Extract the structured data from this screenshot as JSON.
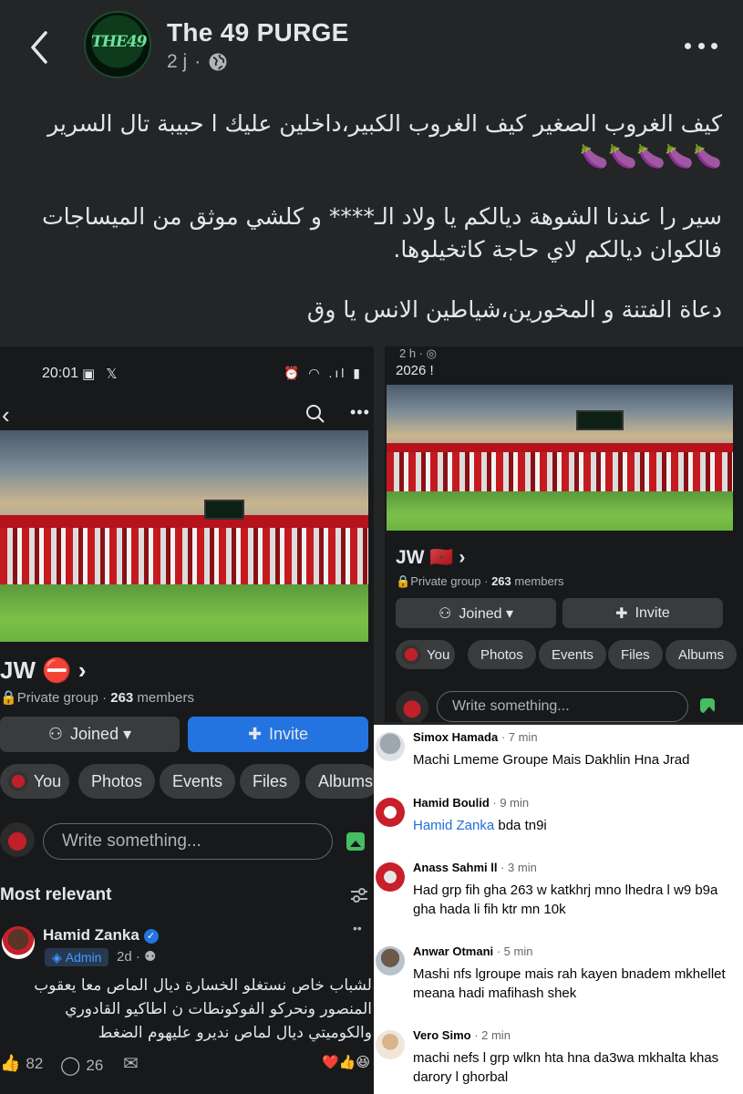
{
  "post": {
    "page_name": "The 49 PURGE",
    "time": "2 j",
    "visibility_separator": "·",
    "logo_text": "THE49",
    "text_lines": [
      "كيف الغروب الصغير كيف الغروب الكبير،داخلين عليك ا حبيبة تال السرير 🍆🍆🍆🍆🍆",
      "سير را عندنا الشوهة ديالكم يا ولاد الـ**** و كلشي موثق من الميساجات فالكوان ديالكم لاي حاجة كاتخيلوها.",
      "دعاة الفتنة و المخورين،شياطين الانس يا وق"
    ]
  },
  "left_shot": {
    "status_time": "20:01",
    "status_icons_left": "▣ 𝕏",
    "status_icons_right": "⏰ ◠ .ıl ▮",
    "group_name": "JW ⛔ ›",
    "group_privacy": "Private group · ",
    "group_members": "263",
    "group_members_label": " members",
    "joined_label": "Joined ▾",
    "invite_label": "Invite",
    "chips": [
      "You",
      "Photos",
      "Events",
      "Files",
      "Albums"
    ],
    "write_placeholder": "Write something...",
    "sort_label": "Most relevant",
    "post_author": "Hamid Zanka",
    "admin_label": "Admin",
    "post_age": "2d ·",
    "post_body": "لشباب خاص نستغلو الخسارة ديال الماص معا يعقوب المنصور ونحركو الفوكونطات ن اطاكيو القادوري والكوميتي ديال لماص نديرو عليهوم الضغط",
    "likes": "82",
    "comments": "26"
  },
  "right_shot": {
    "top_meta": "2 h · ◎",
    "year_text": "2026 !",
    "group_name": "JW 🇲🇦 ›",
    "group_privacy": "Private group · ",
    "group_members": "263",
    "group_members_label": " members",
    "joined_label": "Joined ▾",
    "invite_label": "Invite",
    "chips": [
      "You",
      "Photos",
      "Events",
      "Files",
      "Albums"
    ],
    "write_placeholder": "Write something..."
  },
  "comments": [
    {
      "name": "Simox Hamada",
      "time": " · 7 min",
      "text": "Machi Lmeme Groupe Mais Dakhlin Hna Jrad",
      "mention": ""
    },
    {
      "name": "Hamid Boulid",
      "time": " · 9 min",
      "text": " bda tn9i",
      "mention": "Hamid Zanka"
    },
    {
      "name": "Anass Sahmi ll",
      "time": " · 3 min",
      "text": "Had grp fih gha 263 w katkhrj mno lhedra l w9 b9a gha hada li fih ktr mn 10k",
      "mention": ""
    },
    {
      "name": "Anwar Otmani",
      "time": " · 5 min",
      "text": "Mashi nfs lgroupe mais rah kayen bnadem mkhellet meana hadi mafihash shek",
      "mention": ""
    },
    {
      "name": "Vero Simo",
      "time": " · 2 min",
      "text": "machi nefs l grp wlkn hta hna da3wa mkhalta khas darory l ghorbal",
      "mention": ""
    }
  ],
  "colors": {
    "background": "#242526",
    "fb_blue": "#2374e1",
    "text_primary": "#e4e6eb",
    "text_secondary": "#b0b3b8"
  }
}
